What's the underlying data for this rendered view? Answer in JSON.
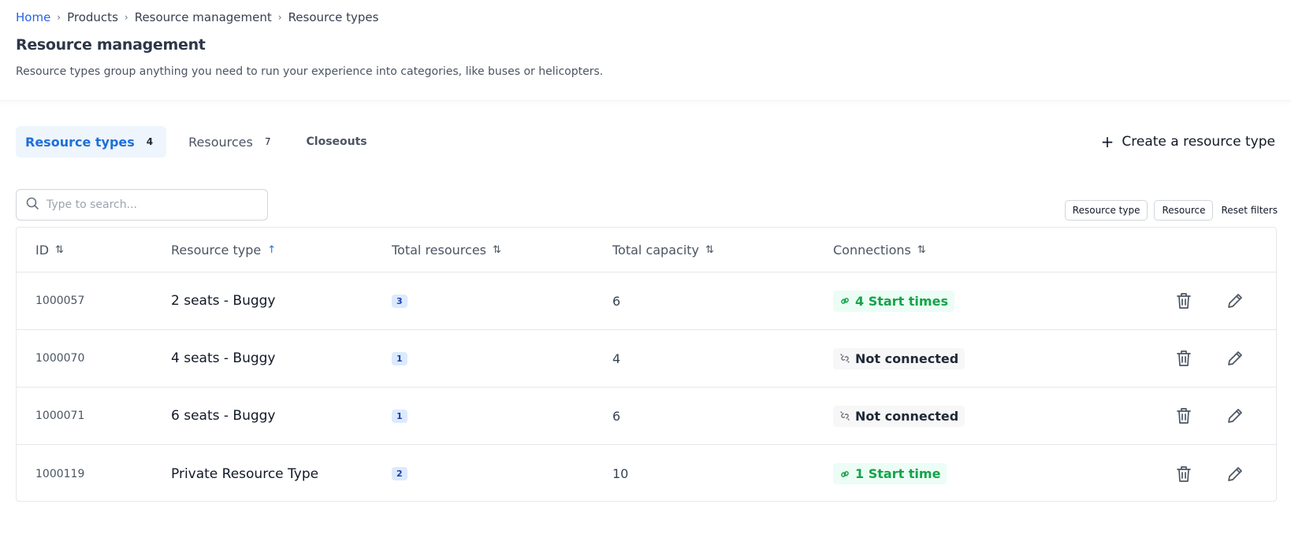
{
  "breadcrumb": [
    "Home",
    "Products",
    "Resource management",
    "Resource types"
  ],
  "page": {
    "title": "Resource management",
    "description": "Resource types group anything you need to run your experience into categories, like buses or helicopters."
  },
  "tabs": [
    {
      "label": "Resource types",
      "count": "4",
      "active": true
    },
    {
      "label": "Resources",
      "count": "7",
      "active": false
    },
    {
      "label": "Closeouts",
      "count": "",
      "active": false
    }
  ],
  "create_button": {
    "label": "Create a resource type",
    "icon": "plus-icon"
  },
  "search": {
    "placeholder": "Type to search...",
    "value": "",
    "icon": "search-icon"
  },
  "filters": {
    "chips": [
      "Resource type",
      "Resource"
    ],
    "reset_label": "Reset filters"
  },
  "table": {
    "columns": [
      {
        "label": "ID",
        "sort": "unsorted"
      },
      {
        "label": "Resource type",
        "sort": "ascending"
      },
      {
        "label": "Total resources",
        "sort": "unsorted"
      },
      {
        "label": "Total capacity",
        "sort": "unsorted"
      },
      {
        "label": "Connections",
        "sort": "unsorted"
      }
    ],
    "rows": [
      {
        "id": "1000057",
        "type": "2 seats - Buggy",
        "total": "3",
        "capacity": "6",
        "connection": "4 Start times",
        "connected": true
      },
      {
        "id": "1000070",
        "type": "4 seats - Buggy",
        "total": "1",
        "capacity": "4",
        "connection": "Not connected",
        "connected": false
      },
      {
        "id": "1000071",
        "type": "6 seats - Buggy",
        "total": "1",
        "capacity": "6",
        "connection": "Not connected",
        "connected": false
      },
      {
        "id": "1000119",
        "type": "Private Resource Type",
        "total": "2",
        "capacity": "10",
        "connection": "1 Start time",
        "connected": true
      }
    ]
  },
  "colors": {
    "accent": "#1e6fd9",
    "success": "#16a34a",
    "badge_bg": "#dbeafe"
  }
}
